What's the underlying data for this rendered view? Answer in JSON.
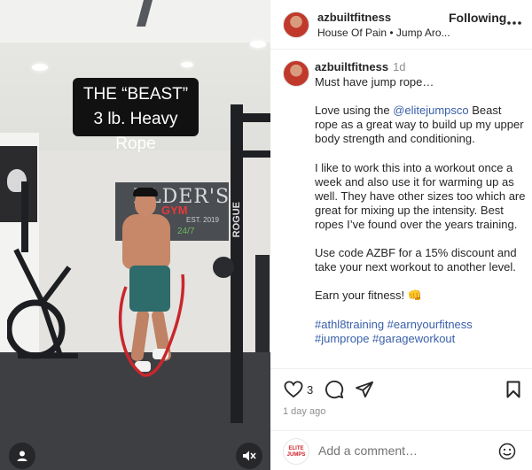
{
  "media": {
    "caption_line1": "THE “BEAST”",
    "caption_line2": "3 lb. Heavy Rope",
    "gym_sign_name": "ELDER'S",
    "gym_sign_sub": "GYM",
    "gym_sign_year": "EST. 2019",
    "gym_sign_hours": "24/7",
    "rack_brand": "ROGUE",
    "user_icon": "user-icon",
    "mute_icon": "muted-speaker-icon"
  },
  "header": {
    "username": "azbuiltfitness",
    "follow_label": "Following",
    "subline": "House Of Pain • Jump Aro...",
    "more_icon": "more-icon"
  },
  "post": {
    "username": "azbuiltfitness",
    "time": "1d",
    "p1": "Must have jump rope…",
    "p2_before": "Love using the ",
    "p2_mention": "@elitejumpsco",
    "p2_after": " Beast rope as a great way to build up my upper body strength and conditioning.",
    "p3": "I like to work this into a workout once a week and also use it for warming up as well. They have other sizes too which are great for mixing up the intensity. Best ropes I’ve found over the years training.",
    "p4": "Use code AZBF for a 15% discount and take your next workout to another level.",
    "p5": "Earn your fitness! 👊",
    "hashtags": "#athl8training #earnyourfitness #jumprope #garageworkout"
  },
  "actions": {
    "like_count": "3",
    "date": "1 day ago"
  },
  "comment": {
    "avatar_text": "ELITE JUMPS",
    "placeholder": "Add a comment…"
  },
  "colors": {
    "link": "#385fa8",
    "text": "#262626",
    "muted": "#8e8e8e"
  }
}
